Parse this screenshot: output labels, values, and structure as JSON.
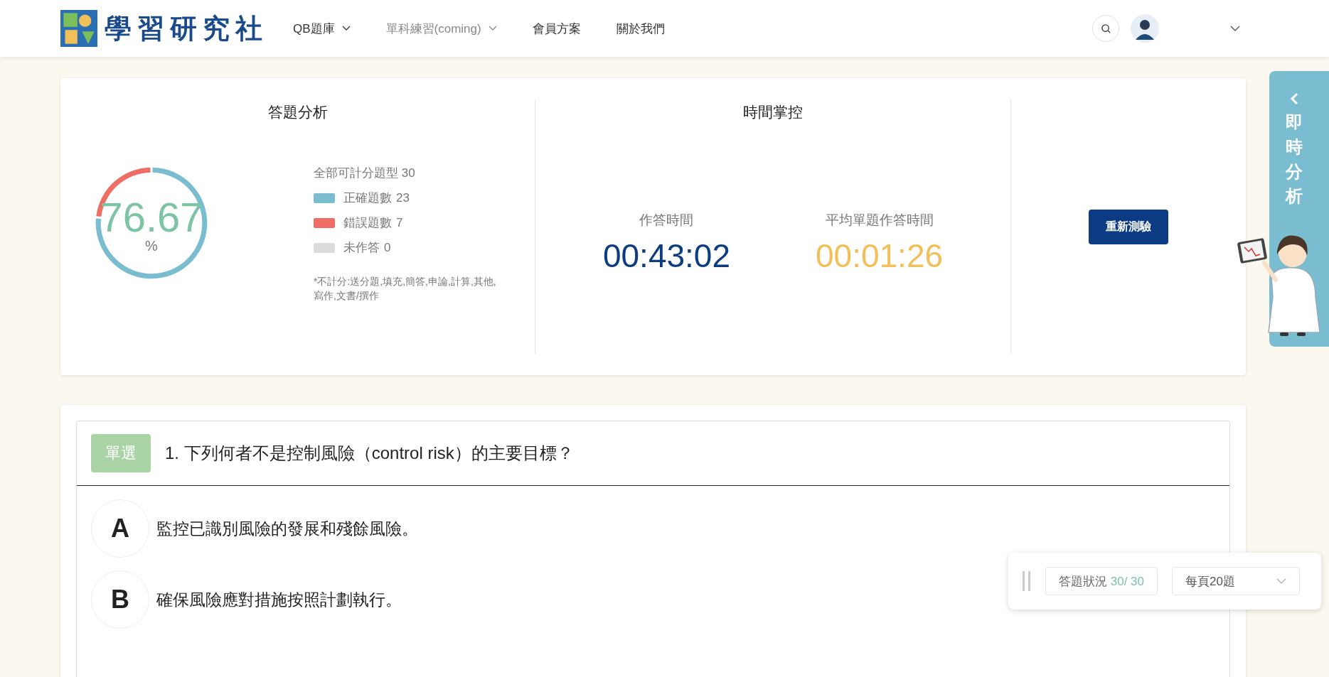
{
  "header": {
    "logo_text": "學習研究社",
    "nav": [
      {
        "label": "QB題庫",
        "has_menu": true,
        "disabled": false
      },
      {
        "label": "單科練習(coming)",
        "has_menu": true,
        "disabled": true
      },
      {
        "label": "會員方案",
        "has_menu": false,
        "disabled": false
      },
      {
        "label": "關於我們",
        "has_menu": false,
        "disabled": false
      }
    ]
  },
  "analysis": {
    "title": "答題分析",
    "score": "76.67",
    "unit": "%",
    "total": "全部可計分題型 30",
    "chart_data": {
      "type": "donut",
      "categories": [
        "正確題數",
        "錯誤題數"
      ],
      "values": [
        76.67,
        23.33
      ]
    },
    "legend": [
      {
        "count": "23",
        "color": "#7bbdd0"
      },
      {
        "count": "7",
        "color": "#ee6e66"
      },
      {
        "label": "未作答",
        "count": "0",
        "color": "#dcdcdc"
      }
    ],
    "note": "*不計分:送分題,填充,簡答,申論,計算,其他,寫作,文書/撰作"
  },
  "time": {
    "title": "時間掌控",
    "items": [
      {
        "label": "作答時間",
        "value": "00:43:02",
        "color": "#0d3c80"
      },
      {
        "label": "平均單題作答時間",
        "value": "00:01:26",
        "color": "#f2c05a"
      }
    ]
  },
  "retest_button": "重新測驗",
  "side_tab": {
    "chars": [
      "即",
      "時",
      "分",
      "析"
    ]
  },
  "question": {
    "type_badge": "單選",
    "text": "1. 下列何者不是控制風險（control risk）的主要目標？",
    "options": [
      {
        "letter": "A",
        "text": "監控已識別風險的發展和殘餘風險。"
      },
      {
        "letter": "B",
        "text": "確保風險應對措施按照計劃執行。"
      }
    ]
  },
  "status_panel": {
    "label": "答題狀況",
    "count": "30/ 30",
    "per_page": "每頁20題"
  }
}
